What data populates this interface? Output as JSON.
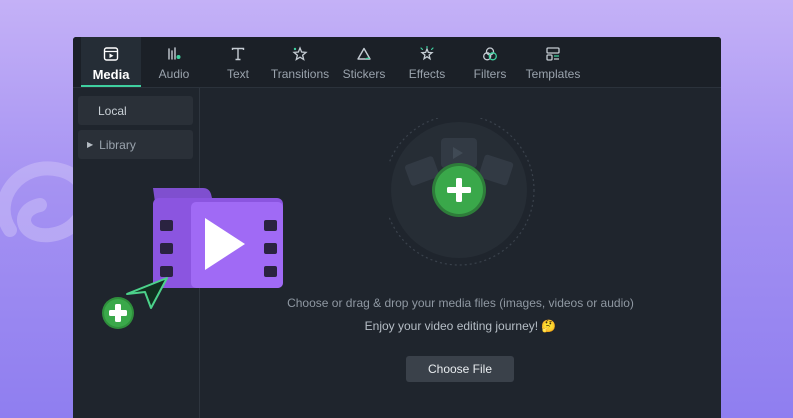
{
  "toolbar": {
    "tabs": [
      {
        "label": "Media",
        "icon": "media-icon"
      },
      {
        "label": "Audio",
        "icon": "audio-icon"
      },
      {
        "label": "Text",
        "icon": "text-icon"
      },
      {
        "label": "Transitions",
        "icon": "transitions-icon"
      },
      {
        "label": "Stickers",
        "icon": "stickers-icon"
      },
      {
        "label": "Effects",
        "icon": "effects-icon"
      },
      {
        "label": "Filters",
        "icon": "filters-icon"
      },
      {
        "label": "Templates",
        "icon": "templates-icon"
      }
    ],
    "active_tab": "Media"
  },
  "sidebar": {
    "items": [
      {
        "label": "Local"
      },
      {
        "label": "Library"
      }
    ]
  },
  "main": {
    "drop_text": "Choose or drag & drop your media files (images, videos or audio)",
    "journey_text": "Enjoy your video editing journey! 🤔",
    "choose_button": "Choose File"
  },
  "colors": {
    "accent": "#3fd0a0",
    "plus_green": "#3aa84a",
    "folder_purple": "#9b5cf0",
    "app_bg": "#1f252d"
  }
}
